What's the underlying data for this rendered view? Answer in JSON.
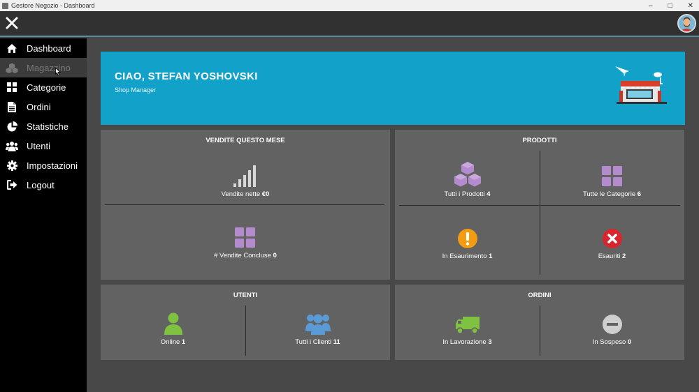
{
  "window": {
    "title": "Gestore Negozio - Dashboard"
  },
  "sidebar": {
    "items": [
      {
        "label": "Dashboard",
        "icon": "home-icon"
      },
      {
        "label": "Magazzino",
        "icon": "boxes-icon"
      },
      {
        "label": "Categorie",
        "icon": "grid-icon"
      },
      {
        "label": "Ordini",
        "icon": "document-icon"
      },
      {
        "label": "Statistiche",
        "icon": "pie-chart-icon"
      },
      {
        "label": "Utenti",
        "icon": "users-icon"
      },
      {
        "label": "Impostazioni",
        "icon": "gear-icon"
      },
      {
        "label": "Logout",
        "icon": "logout-icon"
      }
    ]
  },
  "banner": {
    "greeting": "CIAO, STEFAN YOSHOVSKI",
    "role": "Shop Manager"
  },
  "sales": {
    "title": "VENDITE QUESTO MESE",
    "net_label": "Vendite nette",
    "net_value": "€0",
    "closed_label": "# Vendite Concluse",
    "closed_value": "0"
  },
  "products": {
    "title": "PRODOTTI",
    "all_label": "Tutti i Prodotti",
    "all_value": "4",
    "categories_label": "Tutte le Categorie",
    "categories_value": "6",
    "low_label": "In Esaurimento",
    "low_value": "1",
    "out_label": "Esauriti",
    "out_value": "2"
  },
  "users": {
    "title": "UTENTI",
    "online_label": "Online",
    "online_value": "1",
    "clients_label": "Tutti i Clienti",
    "clients_value": "11"
  },
  "orders": {
    "title": "ORDINI",
    "processing_label": "In Lavorazione",
    "processing_value": "3",
    "suspended_label": "In Sospeso",
    "suspended_value": "0"
  },
  "colors": {
    "banner": "#12a2c9",
    "card": "#636262",
    "purple": "#b48ccd",
    "orange": "#f39c12",
    "red": "#d9252e",
    "green": "#7fc241",
    "blue": "#5b9bd5",
    "grey_icon": "#cfcfcf"
  }
}
